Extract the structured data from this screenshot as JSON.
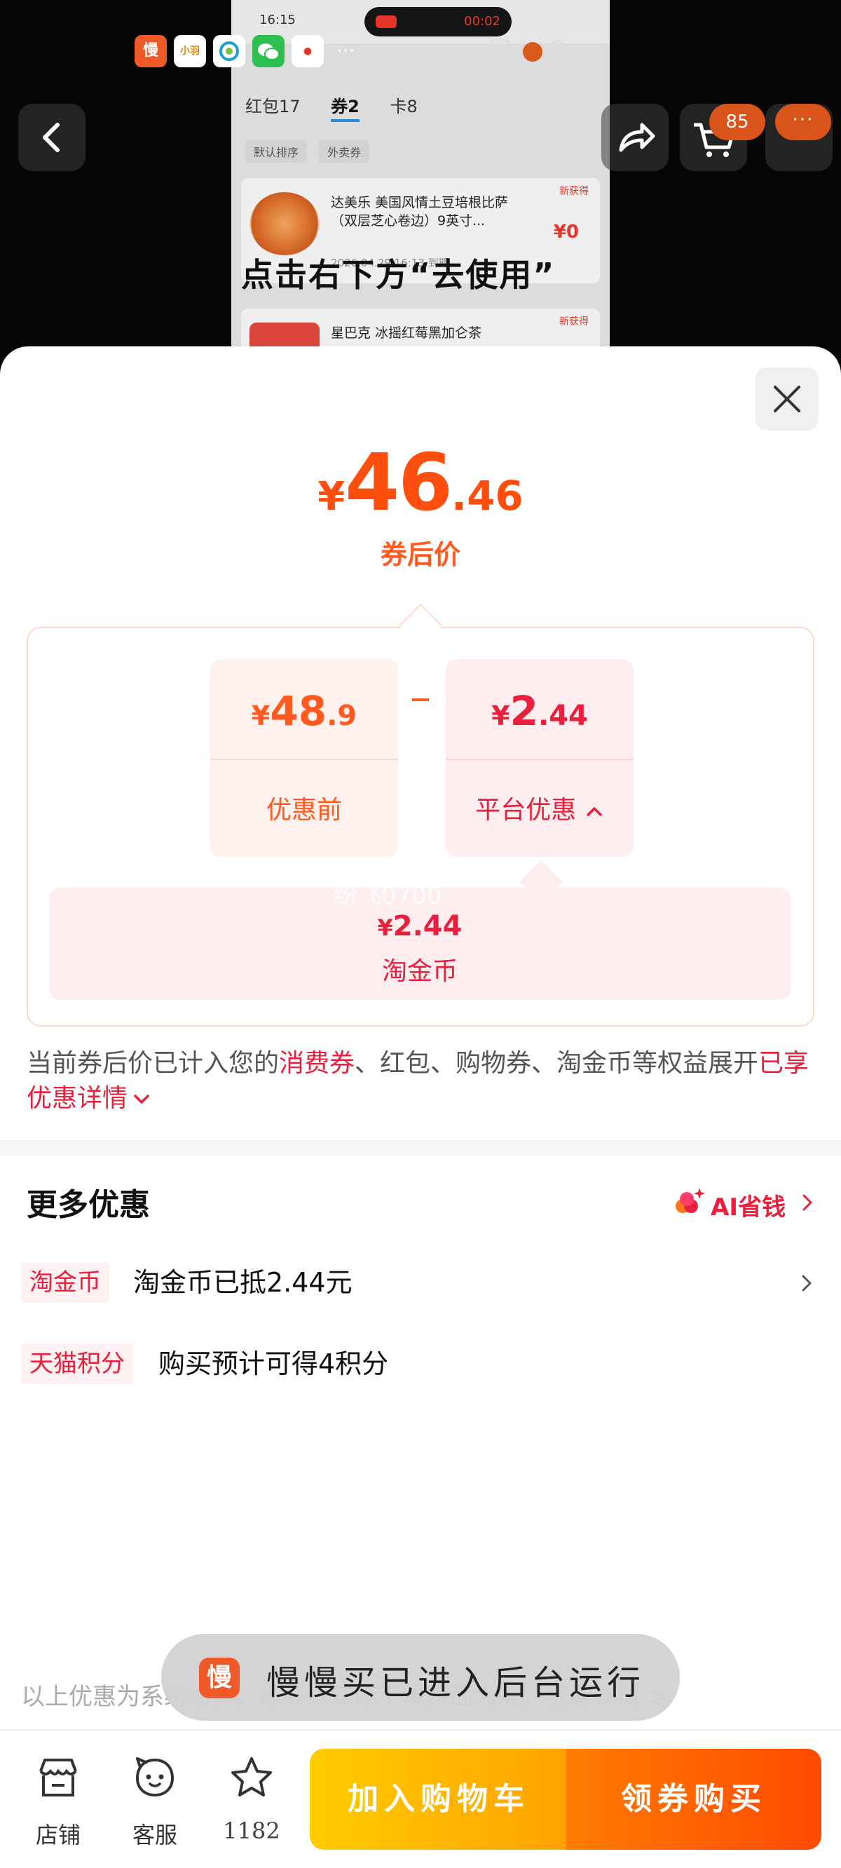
{
  "background": {
    "status_time": "16:15",
    "record_timer": "00:02",
    "app_dots": "···",
    "video_tabs": [
      "红包17",
      "券2",
      "卡8"
    ],
    "video_filters": [
      "默认排序",
      "外卖券"
    ],
    "cards": [
      {
        "title": "达美乐 美国风情土豆培根比萨（双层芝心卷边）9英寸...",
        "date": "2026.04.29 16:13 到期",
        "tag": "新获得",
        "price": "¥0"
      },
      {
        "title": "星巴克 冰摇红莓黑加仑茶",
        "tag": "新获得"
      }
    ],
    "caption": "点击右下方“去使用”",
    "cart_badge": "85",
    "more_badge": "···"
  },
  "sheet": {
    "final_price": {
      "currency": "¥",
      "integer": "46",
      "decimal": ".46"
    },
    "final_label": "券后价",
    "before": {
      "currency": "¥",
      "integer": "48",
      "decimal": ".9",
      "label": "优惠前"
    },
    "platform": {
      "currency": "¥",
      "integer": "2",
      "decimal": ".44",
      "label": "平台优惠"
    },
    "coin": {
      "currency": "¥",
      "value": "2.44",
      "label": "淘金币"
    },
    "watermark": "纷飞0700",
    "note": {
      "prefix": "当前券后价已计入您的",
      "highlight": "消费券",
      "middle": "、红包、购物券、淘金币等权益展开",
      "link": "已享优惠详情"
    },
    "more_title": "更多优惠",
    "ai_link": "AI省钱",
    "rows": [
      {
        "tag": "淘金币",
        "text": "淘金币已抵2.44元"
      },
      {
        "tag": "天猫积分",
        "text": "购买预计可得4积分"
      }
    ],
    "disclaimer": "以上优惠为系统估算，最终以实际下单页面为准，查看详情 >",
    "toast": {
      "logo": "慢",
      "message": "慢慢买已进入后台运行"
    }
  },
  "bottom_bar": {
    "store_label": "店铺",
    "service_label": "客服",
    "favorites_count": "1182",
    "add_to_cart": "加入购物车",
    "buy": "领券购买"
  },
  "colors": {
    "price_orange": "#ff4f0f",
    "discount_red": "#e8203d",
    "cart_yellow": "#ffb400",
    "buy_orange": "#ff5a00"
  }
}
